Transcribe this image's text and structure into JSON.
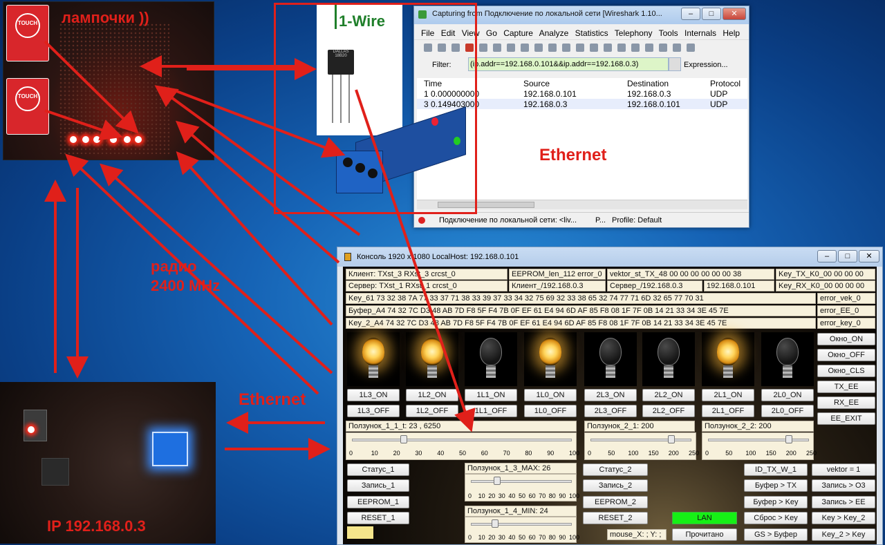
{
  "annotations": {
    "lamps_label": "лампочки ))",
    "radio_label_line1": "радио",
    "radio_label_line2": "2400 MHz",
    "ethernet_top": "Ethernet",
    "ethernet_bottom": "Ethernet",
    "ip_label": "IP 192.168.0.3",
    "onewire_title": "1-Wire",
    "touch_label": "TOUCH",
    "chip_line1": "DALLAS",
    "chip_line2": "18B20"
  },
  "wireshark": {
    "title": "Capturing from Подключение по локальной сети   [Wireshark 1.10...",
    "menu": [
      "File",
      "Edit",
      "View",
      "Go",
      "Capture",
      "Analyze",
      "Statistics",
      "Telephony",
      "Tools",
      "Internals",
      "Help"
    ],
    "filter_label": "Filter:",
    "filter_value": "(ip.addr==192.168.0.101&&ip.addr==192.168.0.3)",
    "expression_label": "Expression...",
    "columns": [
      "Time",
      "Source",
      "Destination",
      "Protocol"
    ],
    "rows": [
      [
        "1 0.000000000",
        "192.168.0.101",
        "192.168.0.3",
        "UDP"
      ],
      [
        "3 0.149403000",
        "192.168.0.3",
        "192.168.0.101",
        "UDP"
      ]
    ],
    "status_interface": "Подключение по локальной сети: <liv...",
    "status_packets": "P...",
    "status_profile": "Profile: Default"
  },
  "console": {
    "title": "Консоль 1920 x 1080 LocalHost: 192.168.0.101",
    "info": {
      "client": "Клиент: TXst_3 RXst_3 crcst_0",
      "eeprom": "EEPROM_len_112 error_0",
      "vektor": "vektor_st_TX_48 00 00 00 00 00 00 38",
      "key_tx": "Key_TX_K0_00 00 00 00",
      "server": "Сервер: TXst_1 RXst_1 crcst_0",
      "client_ip": "Клиент_/192.168.0.3",
      "server_ip": "Сервер_/192.168.0.3",
      "ip": "192.168.0.101",
      "key_rx": "Key_RX_K0_00 00 00 00",
      "key61": "Key_61 73 32 38 7A 77 33 37 71 38 33 39 37 33 34 32 75 69 32 33 38 65 32 74 77 71 6D 32 65 77 70 31",
      "error_vek": "error_vek_0",
      "buffer": "Буфер_A4 74 32 7C D3 48 AB 7D F8 5F F4 7B 0F EF 61 E4 94 6D AF 85 F8 08 1F 7F 0B 14 21 33 34 3E 45 7E",
      "error_ee": "error_EE_0",
      "key2": "Key_2_A4 74 32 7C D3 48 AB 7D F8 5F F4 7B 0F EF 61 E4 94 6D AF 85 F8 08 1F 7F 0B 14 21 33 34 3E 45 7E",
      "error_key": "error_key_0"
    },
    "bulbs": [
      "on",
      "on",
      "off",
      "on",
      "off",
      "off",
      "on",
      "off"
    ],
    "on_buttons": [
      "1L3_ON",
      "1L2_ON",
      "1L1_ON",
      "1L0_ON",
      "2L3_ON",
      "2L2_ON",
      "2L1_ON",
      "2L0_ON"
    ],
    "off_buttons": [
      "1L3_OFF",
      "1L2_OFF",
      "1L1_OFF",
      "1L0_OFF",
      "2L3_OFF",
      "2L2_OFF",
      "2L1_OFF",
      "2L0_OFF"
    ],
    "side_buttons": [
      "Окно_ON",
      "Окно_OFF",
      "Окно_CLS",
      "TX_EE",
      "RX_EE",
      "EE_EXIT"
    ],
    "slider_1_1": {
      "label": "Ползунок_1_1_t: 23 , 6250",
      "value": 23.625,
      "ticks": [
        "0",
        "10",
        "20",
        "30",
        "40",
        "50",
        "60",
        "70",
        "80",
        "90",
        "100"
      ]
    },
    "slider_2_1": {
      "label": "Ползунок_2_1: 200",
      "value": 200,
      "ticks": [
        "0",
        "50",
        "100",
        "150",
        "200",
        "250"
      ]
    },
    "slider_2_2": {
      "label": "Ползунок_2_2: 200",
      "value": 200,
      "ticks": [
        "0",
        "50",
        "100",
        "150",
        "200",
        "250"
      ]
    },
    "slider_1_3": {
      "label": "Ползунок_1_3_MAX: 26",
      "value": 26,
      "ticks": [
        "0",
        "10",
        "20",
        "30",
        "40",
        "50",
        "60",
        "70",
        "80",
        "90",
        "100"
      ]
    },
    "slider_1_4": {
      "label": "Ползунок_1_4_MIN: 24",
      "value": 24,
      "ticks": [
        "0",
        "10",
        "20",
        "30",
        "40",
        "50",
        "60",
        "70",
        "80",
        "90",
        "100"
      ]
    },
    "left_buttons": [
      "Статус_1",
      "Запись_1",
      "EEPROM_1",
      "RESET_1"
    ],
    "mid_buttons": [
      "Статус_2",
      "Запись_2",
      "EEPROM_2",
      "RESET_2"
    ],
    "mouse_label": "mouse_X: ; Y: ;",
    "lan_label": "LAN",
    "lan_color": "#16f016",
    "read_button": "Прочитано",
    "right_col1": [
      "ID_TX_W_1",
      "Буфер > TX",
      "Буфер > Key",
      "Сброс > Key",
      "GS > Буфер"
    ],
    "right_col2": [
      "vektor = 1",
      "Запись > O3",
      "Запись > EE",
      "Key > Key_2",
      "Key_2 > Key"
    ]
  }
}
